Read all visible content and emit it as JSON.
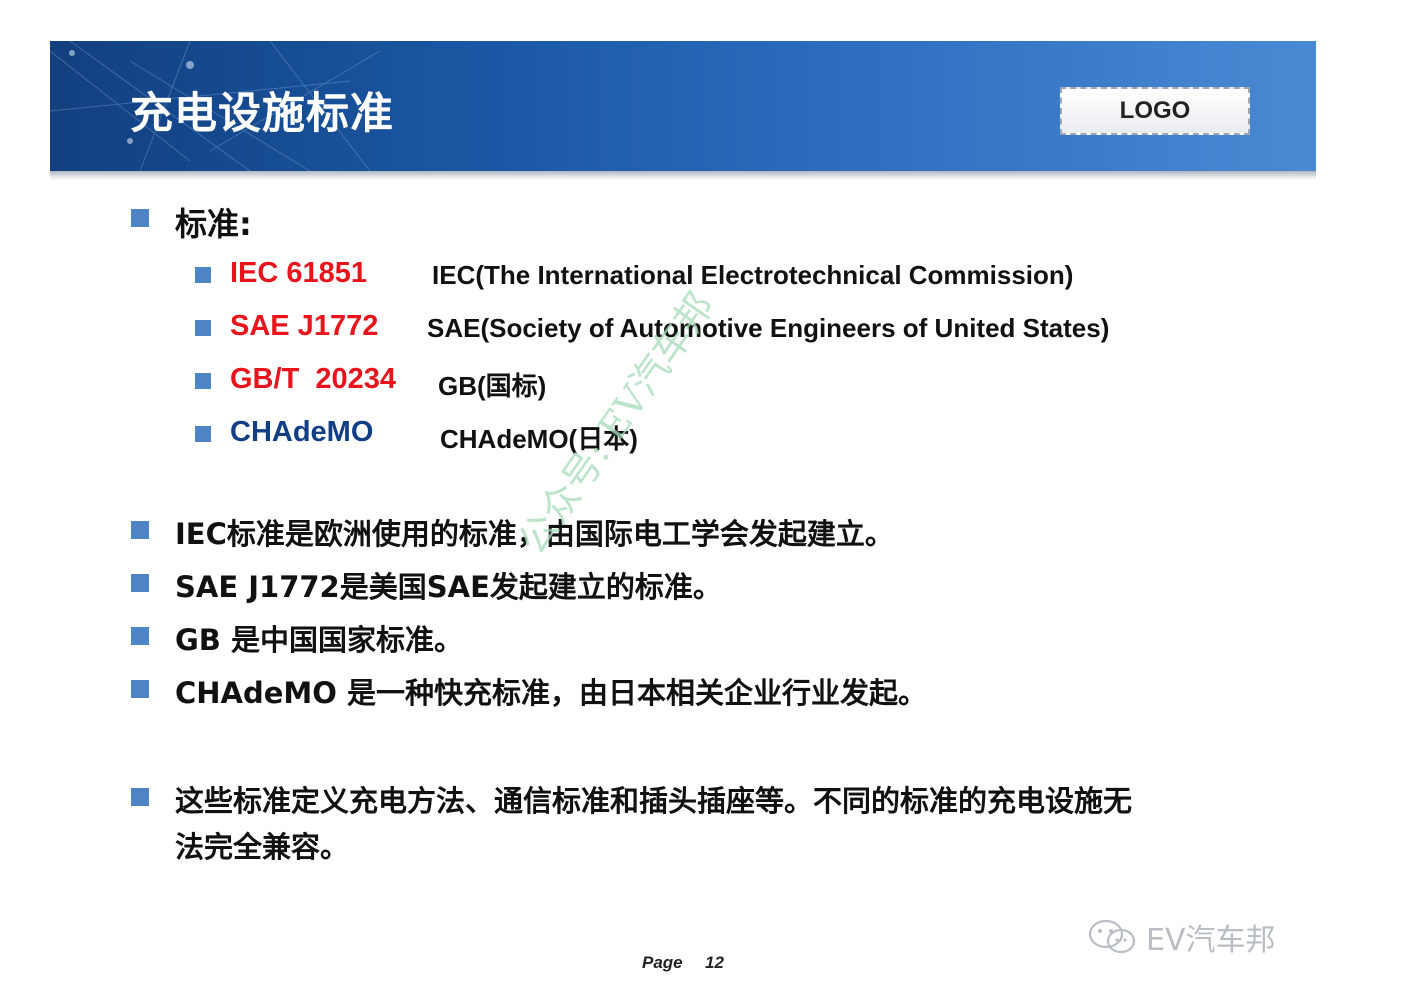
{
  "header": {
    "title": "充电设施标准",
    "logo_label": "LOGO"
  },
  "section_label": "标准:",
  "standards": [
    {
      "code": "IEC 61851",
      "description": "IEC(The International Electrotechnical Commission)",
      "code_color": "#e8141c"
    },
    {
      "code": "SAE J1772",
      "description": "SAE(Society of Automotive Engineers of United States)",
      "code_color": "#e8141c"
    },
    {
      "code": "GB/T  20234",
      "description": "GB(国标)",
      "code_color": "#e8141c"
    },
    {
      "code": "CHAdeMO",
      "description": "CHAdeMO(日本)",
      "code_color": "#123f84"
    }
  ],
  "notes": [
    "IEC标准是欧洲使用的标准，由国际电工学会发起建立。",
    "SAE J1772是美国SAE发起建立的标准。",
    "GB 是中国国家标准。",
    "CHAdeMO 是一种快充标准，由日本相关企业行业发起。"
  ],
  "summary_lines": [
    "这些标准定义充电方法、通信标准和插头插座等。不同的标准的充电设施无",
    "法完全兼容。"
  ],
  "watermark": "公众号: EV汽车邦",
  "footer": {
    "page_word": "Page",
    "page_number": "12"
  },
  "brand": {
    "name": "EV汽车邦",
    "icon": "wechat-icon"
  },
  "colors": {
    "banner": "#1a58a5",
    "bullet": "#4f84c4",
    "code_red": "#e8141c",
    "code_blue": "#123f84"
  }
}
